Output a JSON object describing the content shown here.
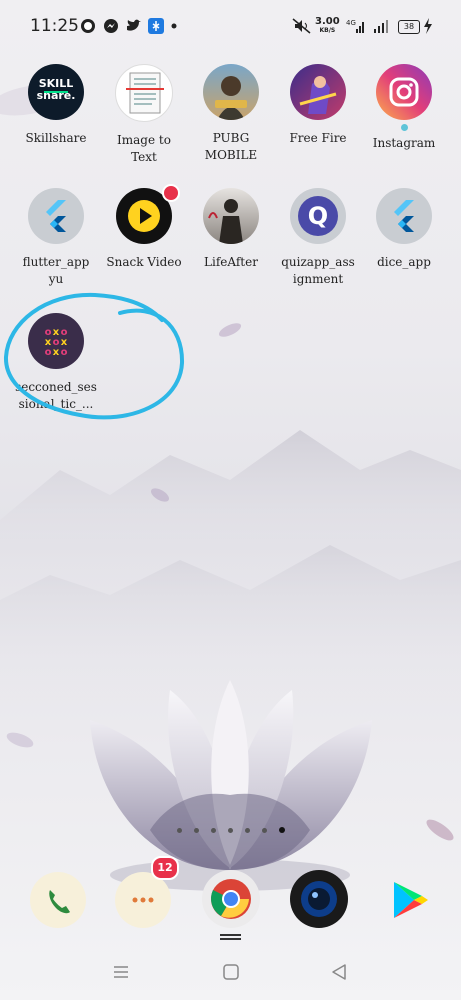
{
  "status_bar": {
    "time": "11:25",
    "net_speed_value": "3.00",
    "net_speed_unit": "KB/S",
    "network_type": "4G",
    "battery": "38"
  },
  "apps": [
    {
      "label": "Skillshare",
      "icon": "skillshare-icon",
      "text": "SKILL\nshare."
    },
    {
      "label": "Image to\nText",
      "icon": "image-to-text-icon"
    },
    {
      "label": "PUBG\nMOBILE",
      "icon": "pubg-icon"
    },
    {
      "label": "Free Fire",
      "icon": "free-fire-icon"
    },
    {
      "label": "Instagram",
      "icon": "instagram-icon"
    },
    {
      "label": "flutter_app\nyu",
      "icon": "flutter-icon"
    },
    {
      "label": "Snack Video",
      "icon": "snack-video-icon"
    },
    {
      "label": "LifeAfter",
      "icon": "lifeafter-icon"
    },
    {
      "label": "quizapp_ass\nignment",
      "icon": "quiz-icon",
      "text": "Q"
    },
    {
      "label": "dice_app",
      "icon": "flutter-icon"
    },
    {
      "label": "secconed_ses\nsional_tic_...",
      "icon": "tic-tac-toe-icon"
    }
  ],
  "dock": {
    "messages_badge": "12",
    "apps": [
      "phone-icon",
      "messages-icon",
      "chrome-icon",
      "camera-icon",
      "play-store-icon"
    ]
  },
  "page_indicator": {
    "count": 7,
    "active": 7
  },
  "colors": {
    "annotation_circle": "#2db7e6",
    "badge": "#e8314a"
  }
}
